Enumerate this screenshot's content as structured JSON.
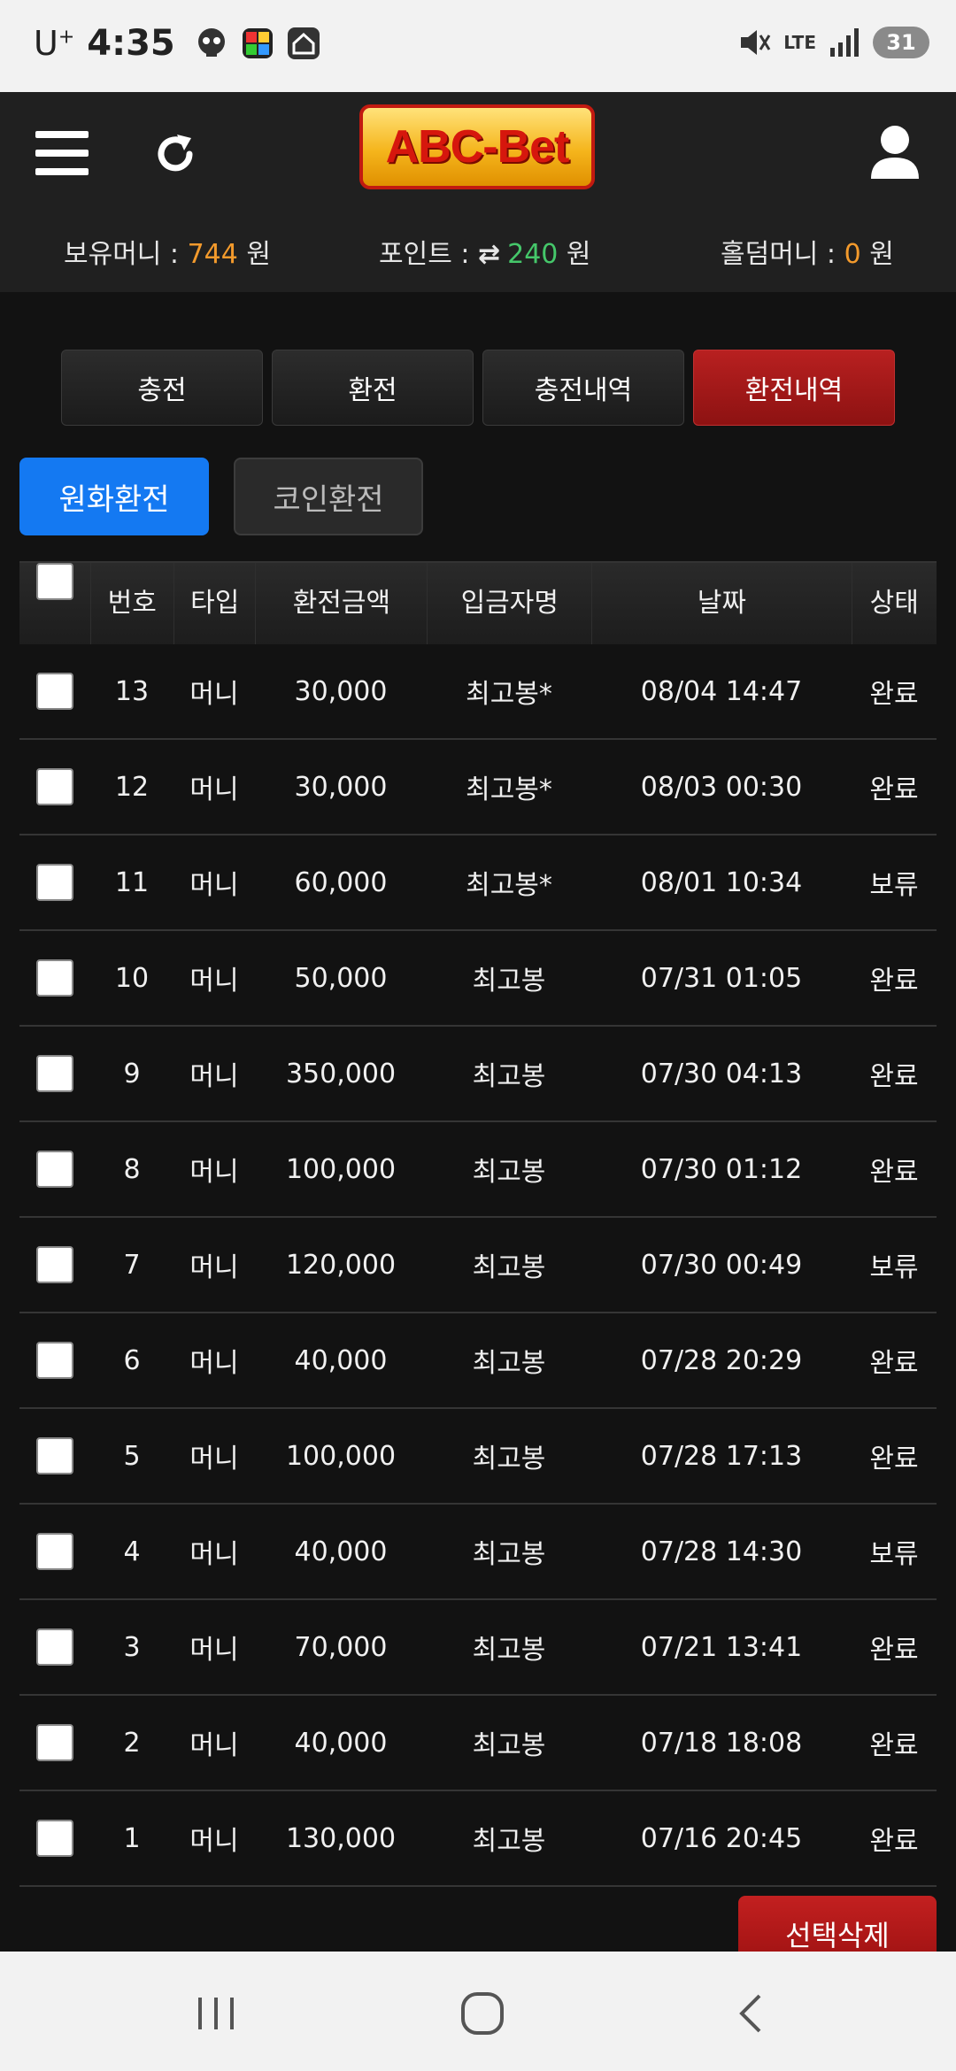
{
  "status_bar": {
    "carrier": "U",
    "carrier_sup": "+",
    "time": "4:35",
    "network": "LTE",
    "battery": "31"
  },
  "header": {
    "logo_text": "ABC-Bet",
    "balances": {
      "money_label": "보유머니 : ",
      "money_value": "744",
      "point_label": "포인트 : ",
      "point_value": "240",
      "holdem_label": "홀덤머니 : ",
      "holdem_value": "0",
      "unit": " 원"
    }
  },
  "tabs": [
    "충전",
    "환전",
    "충전내역",
    "환전내역"
  ],
  "active_tab": "환전내역",
  "subtabs": [
    "원화환전",
    "코인환전"
  ],
  "table": {
    "columns": [
      "번호",
      "타입",
      "환전금액",
      "입금자명",
      "날짜",
      "상태"
    ],
    "rows": [
      [
        "13",
        "머니",
        "30,000",
        "최고봉*",
        "08/04 14:47",
        "완료"
      ],
      [
        "12",
        "머니",
        "30,000",
        "최고봉*",
        "08/03 00:30",
        "완료"
      ],
      [
        "11",
        "머니",
        "60,000",
        "최고봉*",
        "08/01 10:34",
        "보류"
      ],
      [
        "10",
        "머니",
        "50,000",
        "최고봉",
        "07/31 01:05",
        "완료"
      ],
      [
        "9",
        "머니",
        "350,000",
        "최고봉",
        "07/30 04:13",
        "완료"
      ],
      [
        "8",
        "머니",
        "100,000",
        "최고봉",
        "07/30 01:12",
        "완료"
      ],
      [
        "7",
        "머니",
        "120,000",
        "최고봉",
        "07/30 00:49",
        "보류"
      ],
      [
        "6",
        "머니",
        "40,000",
        "최고봉",
        "07/28 20:29",
        "완료"
      ],
      [
        "5",
        "머니",
        "100,000",
        "최고봉",
        "07/28 17:13",
        "완료"
      ],
      [
        "4",
        "머니",
        "40,000",
        "최고봉",
        "07/28 14:30",
        "보류"
      ],
      [
        "3",
        "머니",
        "70,000",
        "최고봉",
        "07/21 13:41",
        "완료"
      ],
      [
        "2",
        "머니",
        "40,000",
        "최고봉",
        "07/18 18:08",
        "완료"
      ],
      [
        "1",
        "머니",
        "130,000",
        "최고봉",
        "07/16 20:45",
        "완료"
      ]
    ]
  },
  "delete_button": "선택삭제",
  "colors": {
    "accent_blue": "#1479f2",
    "active_red": "#b82020",
    "money_orange": "#f39a2c",
    "point_green": "#45c76a"
  },
  "icons": {
    "menu": "hamburger-icon",
    "refresh": "refresh-icon",
    "user": "user-icon",
    "exchange": "exchange-arrows-icon"
  }
}
